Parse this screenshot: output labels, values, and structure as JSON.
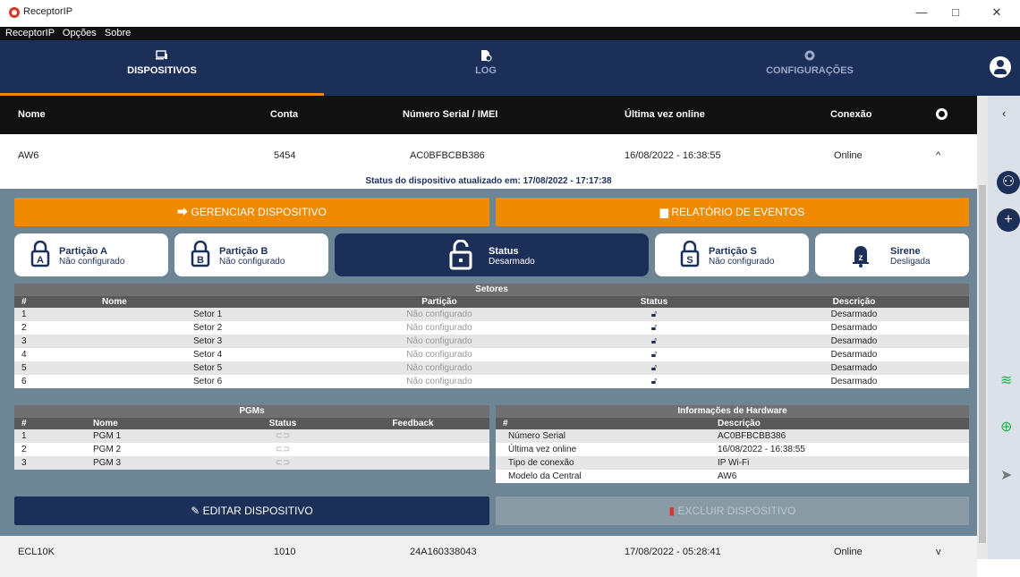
{
  "window": {
    "title": "ReceptorIP",
    "minimize": "—",
    "maximize": "□",
    "close": "✕"
  },
  "menu": [
    "ReceptorIP",
    "Opções",
    "Sobre"
  ],
  "nav": {
    "tabs": [
      "DISPOSITIVOS",
      "LOG",
      "CONFIGURAÇÕES"
    ],
    "active": "DISPOSITIVOS"
  },
  "columns": {
    "nome": "Nome",
    "conta": "Conta",
    "serial": "Número Serial / IMEI",
    "ultima": "Última vez online",
    "conexao": "Conexão"
  },
  "devices": [
    {
      "nome": "AW6",
      "conta": "5454",
      "serial": "AC0BFBCBB386",
      "ultima": "16/08/2022 - 16:38:55",
      "conexao": "Online",
      "chevron": "^"
    },
    {
      "nome": "ECL10K",
      "conta": "1010",
      "serial": "24A160338043",
      "ultima": "17/08/2022 - 05:28:41",
      "conexao": "Online",
      "chevron": "v"
    }
  ],
  "status_line": "Status do dispositivo atualizado em: 17/08/2022 - 17:17:38",
  "buttons": {
    "gerenciar": "GERENCIAR DISPOSITIVO",
    "relatorio": "RELATÓRIO DE EVENTOS",
    "editar": "EDITAR DISPOSITIVO",
    "excluir": "EXCLUIR DISPOSITIVO"
  },
  "cards": [
    {
      "title": "Partição A",
      "sub": "Não configurado",
      "letter": "A"
    },
    {
      "title": "Partição B",
      "sub": "Não configurado",
      "letter": "B"
    },
    {
      "title": "Status",
      "sub": "Desarmado",
      "letter": ""
    },
    {
      "title": "Partição S",
      "sub": "Não configurado",
      "letter": "S"
    },
    {
      "title": "Sirene",
      "sub": "Desligada",
      "letter": "z"
    }
  ],
  "setores": {
    "title": "Setores",
    "headers": [
      "#",
      "Nome",
      "Partição",
      "Status",
      "Descrição"
    ],
    "rows": [
      [
        "1",
        "Setor 1",
        "Não configurado",
        "Desarmado"
      ],
      [
        "2",
        "Setor 2",
        "Não configurado",
        "Desarmado"
      ],
      [
        "3",
        "Setor 3",
        "Não configurado",
        "Desarmado"
      ],
      [
        "4",
        "Setor 4",
        "Não configurado",
        "Desarmado"
      ],
      [
        "5",
        "Setor 5",
        "Não configurado",
        "Desarmado"
      ],
      [
        "6",
        "Setor 6",
        "Não configurado",
        "Desarmado"
      ]
    ]
  },
  "pgms": {
    "title": "PGMs",
    "headers": [
      "#",
      "Nome",
      "Status",
      "Feedback"
    ],
    "rows": [
      [
        "1",
        "PGM 1"
      ],
      [
        "2",
        "PGM 2"
      ],
      [
        "3",
        "PGM 3"
      ]
    ]
  },
  "hardware": {
    "title": "Informações de Hardware",
    "headers": [
      "#",
      "Descrição"
    ],
    "rows": [
      [
        "Número Serial",
        "AC0BFBCBB386"
      ],
      [
        "Última vez online",
        "16/08/2022 - 16:38:55"
      ],
      [
        "Tipo de conexão",
        "IP Wi-Fi"
      ],
      [
        "Modelo da Central",
        "AW6"
      ]
    ]
  },
  "colors": {
    "navy": "#1c2f59",
    "orange": "#f08a00",
    "panel": "#6d8594"
  }
}
